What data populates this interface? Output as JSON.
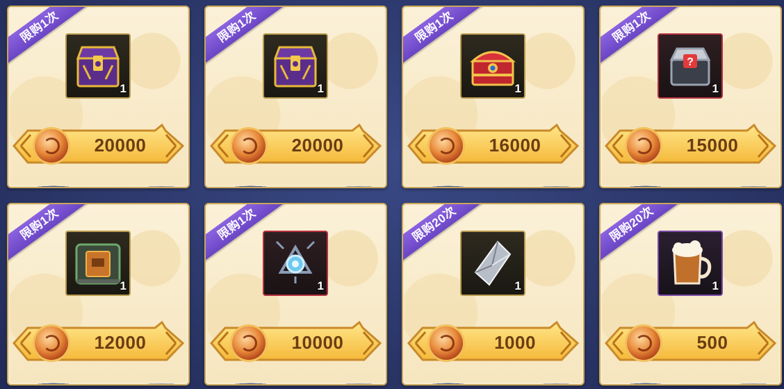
{
  "items": [
    {
      "limit_label": "限购1次",
      "count": "1",
      "price": "20000",
      "icon": "purple-gold-chest-icon",
      "frame": "gold"
    },
    {
      "limit_label": "限购1次",
      "count": "1",
      "price": "20000",
      "icon": "purple-gold-chest-icon",
      "frame": "gold"
    },
    {
      "limit_label": "限购1次",
      "count": "1",
      "price": "16000",
      "icon": "red-treasure-chest-icon",
      "frame": "gold"
    },
    {
      "limit_label": "限购1次",
      "count": "1",
      "price": "15000",
      "icon": "mystery-box-icon",
      "frame": "red"
    },
    {
      "limit_label": "限购1次",
      "count": "1",
      "price": "12000",
      "icon": "mech-core-box-icon",
      "frame": "gold"
    },
    {
      "limit_label": "限购1次",
      "count": "1",
      "price": "10000",
      "icon": "crystal-chain-icon",
      "frame": "red"
    },
    {
      "limit_label": "限购20次",
      "count": "1",
      "price": "1000",
      "icon": "silver-crystal-icon",
      "frame": "gold"
    },
    {
      "limit_label": "限购20次",
      "count": "1",
      "price": "500",
      "icon": "beer-mug-icon",
      "frame": "purple"
    }
  ],
  "colors": {
    "ribbon": "#7a52d4",
    "price_text": "#6b3d12",
    "coin": "#e88a3a",
    "background": "#2b3668"
  }
}
